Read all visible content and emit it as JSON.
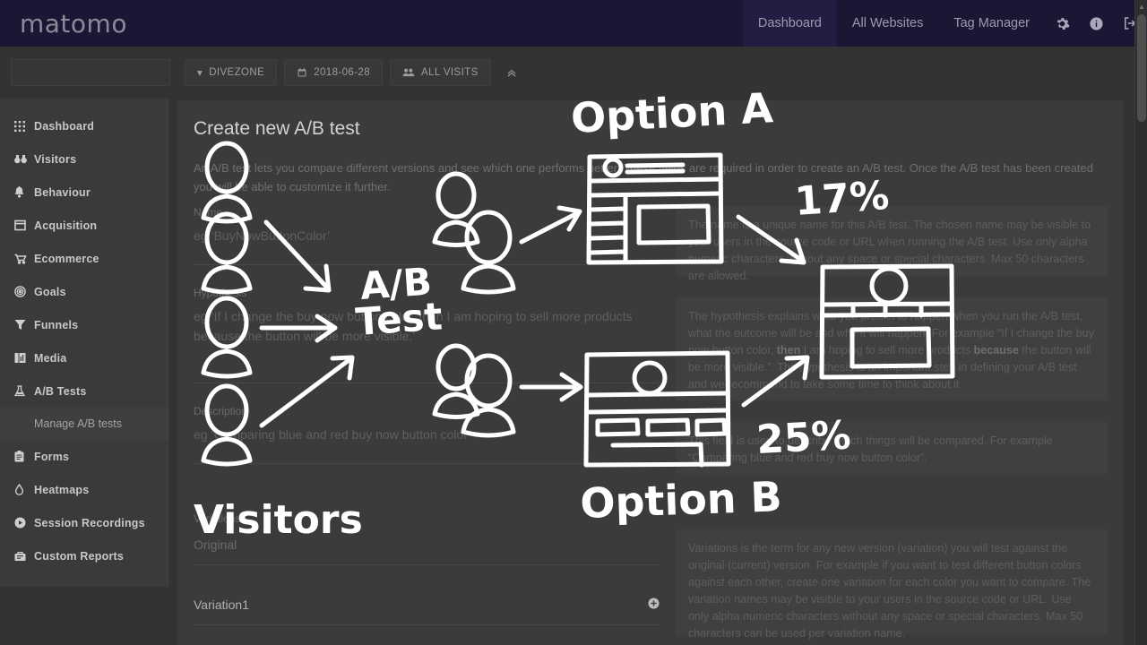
{
  "topbar": {
    "logo": "matomo",
    "nav": [
      {
        "label": "Dashboard",
        "active": true
      },
      {
        "label": "All Websites",
        "active": false
      },
      {
        "label": "Tag Manager",
        "active": false
      }
    ],
    "icons": [
      {
        "name": "gear-icon",
        "label": "Settings"
      },
      {
        "name": "info-icon",
        "label": "Help"
      },
      {
        "name": "logout-icon",
        "label": "Sign out"
      }
    ]
  },
  "filterbar": {
    "search_placeholder": "",
    "search_value": "",
    "site_selector": "DIVEZONE",
    "date_selector": "2018-06-28",
    "segment_selector": "ALL VISITS",
    "collapse_label": "«"
  },
  "sidebar": {
    "items": [
      {
        "label": "Dashboard",
        "icon": "grid-icon"
      },
      {
        "label": "Visitors",
        "icon": "binoculars-icon"
      },
      {
        "label": "Behaviour",
        "icon": "bell-icon"
      },
      {
        "label": "Acquisition",
        "icon": "window-icon"
      },
      {
        "label": "Ecommerce",
        "icon": "cart-icon"
      },
      {
        "label": "Goals",
        "icon": "target-icon"
      },
      {
        "label": "Funnels",
        "icon": "funnel-icon"
      },
      {
        "label": "Media",
        "icon": "media-icon"
      },
      {
        "label": "A/B Tests",
        "icon": "flask-icon"
      }
    ],
    "sub_item": {
      "label": "Manage A/B tests",
      "parent": "A/B Tests"
    },
    "items_after": [
      {
        "label": "Forms",
        "icon": "clipboard-icon"
      },
      {
        "label": "Heatmaps",
        "icon": "droplet-icon"
      },
      {
        "label": "Session Recordings",
        "icon": "play-icon"
      },
      {
        "label": "Custom Reports",
        "icon": "report-icon"
      }
    ]
  },
  "main": {
    "title": "Create new A/B test",
    "intro": "An A/B test lets you compare different versions and see which one performs better. These fields are required in order to create an A/B test. Once the A/B test has been created you will be able to customize it further.",
    "fields": [
      {
        "label": "Name",
        "placeholder": "eg ‘BuyNowButtonColor’",
        "value": "",
        "help": "The name is a unique name for this A/B test. The chosen name may be visible to your users in the source code or URL when running the A/B test. Use only alpha numeric characters without any space or special characters. Max 50 characters are allowed."
      },
      {
        "label": "Hypothesis",
        "placeholder": "eg ‘If I change the buy now button color, then I am hoping to sell more products because the button will be more visible.’",
        "value": "",
        "help_parts": [
          {
            "text": "The hypothesis explains what you predict to happen when you run the A/B test, what the outcome will be and why it will happen. For example “If I change the buy now button color, ",
            "bold": false
          },
          {
            "text": "then",
            "bold": true
          },
          {
            "text": " I am hoping to sell more products ",
            "bold": false
          },
          {
            "text": "because",
            "bold": true
          },
          {
            "text": " the button will be more visible.”. The hypothesis is an important step in defining your A/B test and we recommend to take some time to think about it.",
            "bold": false
          }
        ]
      },
      {
        "label": "Description",
        "placeholder": "eg ‘Comparing blue and red buy now button color’",
        "value": "",
        "help": "This field is used to describe which things will be compared. For example “Comparing blue and red buy now button color”."
      }
    ],
    "variations": {
      "label": "Variations",
      "help": "Variations is the term for any new version (variation) you will test against the original (current) version. For example if you want to test different button colors against each other, create one variation for each color you want to compare. The variation names may be visible to your users in the source code or URL. Use only alpha numeric characters without any space or special characters. Max 50 characters can be used per variation name.",
      "rows": [
        {
          "name": "Original",
          "editable": false,
          "add": false
        },
        {
          "name": "Variation1",
          "editable": true,
          "add": true
        }
      ],
      "add_icon": "plus-circle-icon"
    }
  },
  "annotations": {
    "option_a_label": "Option A",
    "option_b_label": "Option B",
    "ab_test_label_line1": "A/B",
    "ab_test_label_line2": "Test",
    "visitors_label": "Visitors",
    "percent_a": "17%",
    "percent_b": "25%",
    "ink_color": "#ffffff"
  },
  "colors": {
    "topbar_bg": "#1a1634",
    "page_bg": "#333333",
    "card_bg": "#3b3b3b",
    "sidebar_bg": "#3a3a3a",
    "help_bg": "#404040",
    "ink": "#ffffff",
    "muted_text": "#6b6b6b"
  }
}
